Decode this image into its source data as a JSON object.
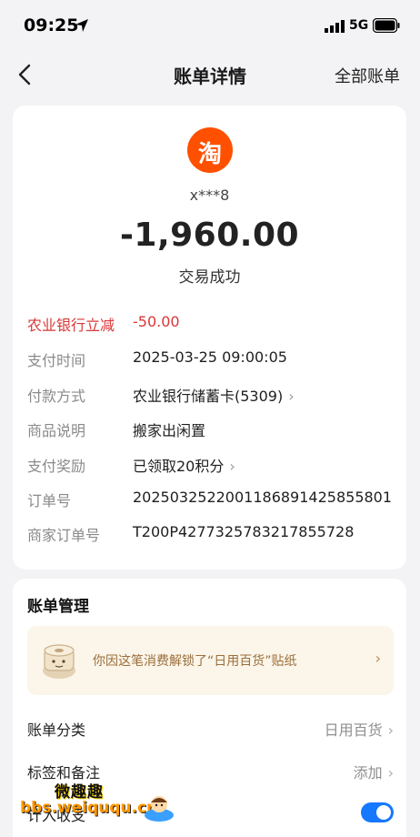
{
  "status_bar": {
    "time": "09:25",
    "network": "5G"
  },
  "nav": {
    "title": "账单详情",
    "right_link": "全部账单"
  },
  "merchant": {
    "logo_char": "淘",
    "name": "x***8",
    "logo_color": "#ff5000"
  },
  "transaction": {
    "amount": "-1,960.00",
    "status": "交易成功",
    "details": [
      {
        "label": "农业银行立减",
        "value": "-50.00",
        "highlight": true,
        "chevron": false
      },
      {
        "label": "支付时间",
        "value": "2025-03-25 09:00:05",
        "chevron": false
      },
      {
        "label": "付款方式",
        "value": "农业银行储蓄卡(5309)",
        "chevron": true
      },
      {
        "label": "商品说明",
        "value": "搬家出闲置",
        "chevron": false
      },
      {
        "label": "支付奖励",
        "value": "已领取20积分",
        "chevron": true
      },
      {
        "label": "订单号",
        "value": "2025032522001186891425855801",
        "chevron": false
      },
      {
        "label": "商家订单号",
        "value": "T200P4277325783217855728",
        "chevron": false
      }
    ]
  },
  "manage": {
    "title": "账单管理",
    "banner_text": "你因这笔消费解锁了“日用百货”贴纸",
    "category": {
      "label": "账单分类",
      "value": "日用百货"
    },
    "tags": {
      "label": "标签和备注",
      "value": "添加"
    },
    "include": {
      "label": "计入收支",
      "enabled": true
    }
  },
  "watermark": {
    "text": "微趣趣",
    "url": "bbs.weiququ.cn"
  },
  "colors": {
    "accent": "#1677ff",
    "discount": "#d93737",
    "taobao": "#ff5000"
  }
}
